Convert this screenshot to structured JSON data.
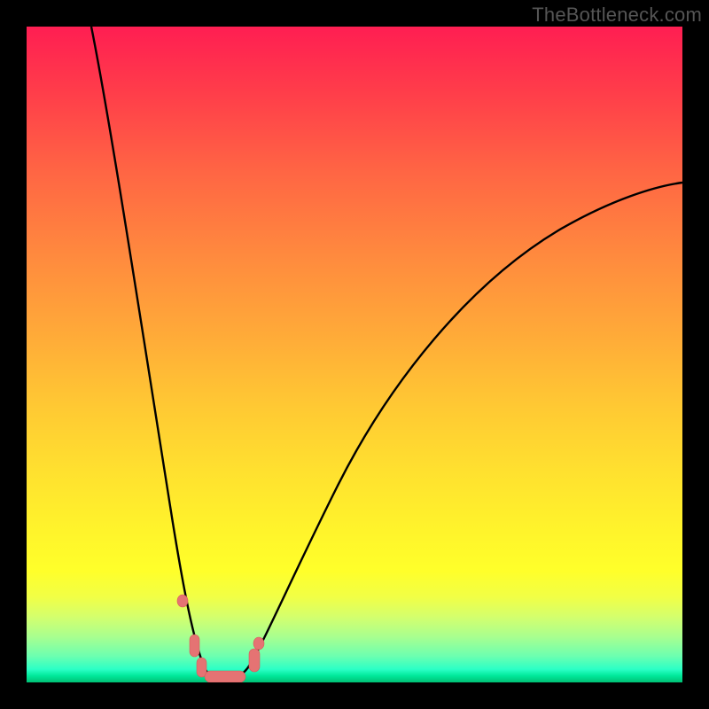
{
  "attribution": "TheBottleneck.com",
  "colors": {
    "frame": "#000000",
    "curve": "#000000",
    "marker_fill": "#e57373",
    "marker_stroke": "#d85a5a"
  },
  "chart_data": {
    "type": "line",
    "title": "",
    "xlabel": "",
    "ylabel": "",
    "xlim": [
      0,
      100
    ],
    "ylim": [
      0,
      100
    ],
    "grid": false,
    "legend": false,
    "note": "Axes are unlabeled in the source image; x/y are normalized 0–100. y≈0 at the floor (green), y≈100 at the top (red). Left branch falls steeply to a flat minimum near x≈27–34, right branch rises with decreasing slope toward x≈100.",
    "series": [
      {
        "name": "left-branch",
        "x": [
          10,
          12,
          14,
          16,
          18,
          20,
          22,
          24,
          25.5,
          27
        ],
        "values": [
          100,
          86,
          72,
          58,
          45,
          33,
          22,
          12,
          6,
          2
        ]
      },
      {
        "name": "floor",
        "x": [
          27,
          29,
          31,
          33,
          34
        ],
        "values": [
          2,
          0.8,
          0.6,
          0.8,
          2
        ]
      },
      {
        "name": "right-branch",
        "x": [
          34,
          36,
          39,
          43,
          48,
          54,
          61,
          69,
          78,
          88,
          100
        ],
        "values": [
          2,
          7,
          15,
          25,
          36,
          47,
          56,
          63,
          69,
          73,
          76
        ]
      }
    ],
    "markers": {
      "name": "highlighted-points",
      "note": "Pink rounded markers clustered near the minimum of the curve.",
      "points": [
        {
          "x": 24.0,
          "y": 12
        },
        {
          "x": 25.8,
          "y": 5
        },
        {
          "x": 26.8,
          "y": 2
        },
        {
          "x": 28.5,
          "y": 0.8
        },
        {
          "x": 31.0,
          "y": 0.7
        },
        {
          "x": 33.0,
          "y": 1.0
        },
        {
          "x": 34.8,
          "y": 4
        },
        {
          "x": 35.5,
          "y": 6
        }
      ]
    }
  }
}
